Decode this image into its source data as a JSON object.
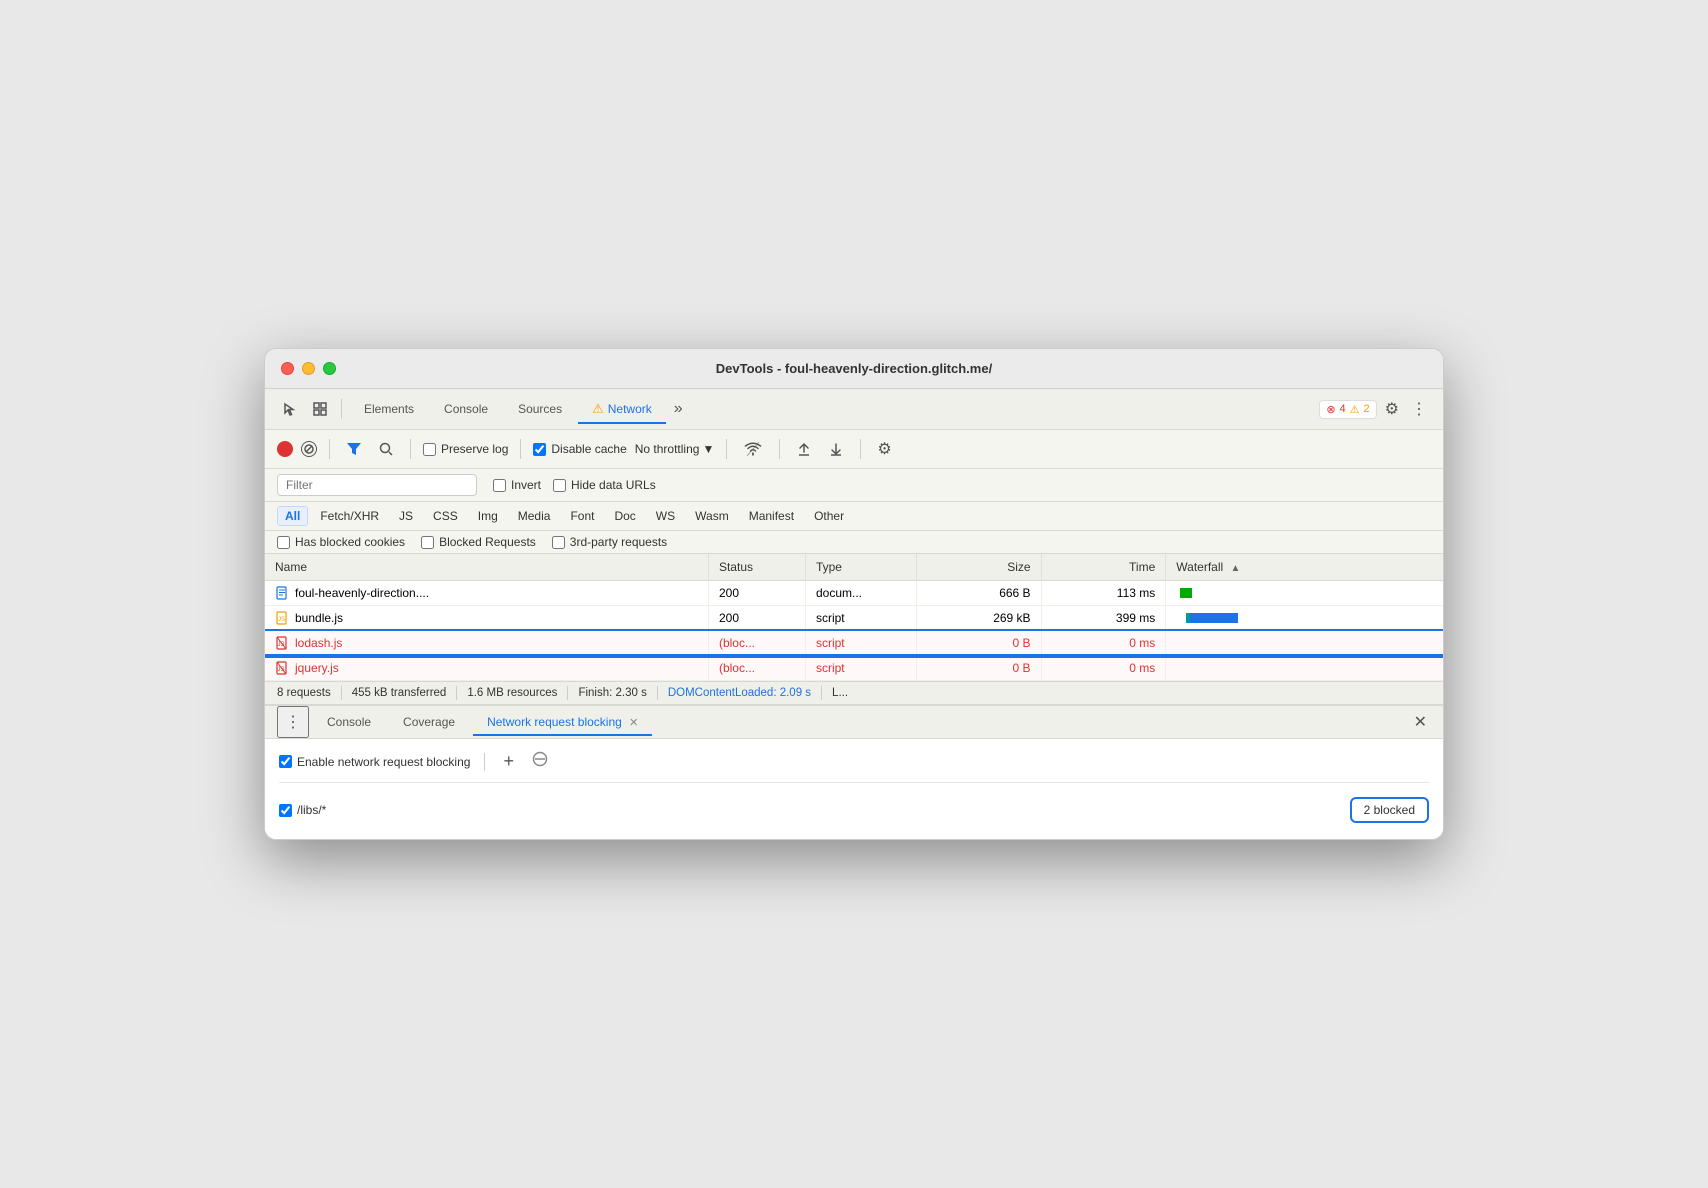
{
  "window": {
    "title": "DevTools - foul-heavenly-direction.glitch.me/"
  },
  "toolbar": {
    "tabs": [
      {
        "id": "elements",
        "label": "Elements",
        "active": false
      },
      {
        "id": "console",
        "label": "Console",
        "active": false
      },
      {
        "id": "sources",
        "label": "Sources",
        "active": false
      },
      {
        "id": "network",
        "label": "Network",
        "active": true
      },
      {
        "id": "more",
        "label": "»",
        "active": false
      }
    ],
    "error_count": "4",
    "warn_count": "2"
  },
  "network_toolbar": {
    "preserve_log_label": "Preserve log",
    "disable_cache_label": "Disable cache",
    "throttle_label": "No throttling"
  },
  "filter_bar": {
    "filter_placeholder": "Filter",
    "invert_label": "Invert",
    "hide_data_urls_label": "Hide data URLs"
  },
  "type_filters": [
    {
      "label": "All",
      "active": true
    },
    {
      "label": "Fetch/XHR",
      "active": false
    },
    {
      "label": "JS",
      "active": false
    },
    {
      "label": "CSS",
      "active": false
    },
    {
      "label": "Img",
      "active": false
    },
    {
      "label": "Media",
      "active": false
    },
    {
      "label": "Font",
      "active": false
    },
    {
      "label": "Doc",
      "active": false
    },
    {
      "label": "WS",
      "active": false
    },
    {
      "label": "Wasm",
      "active": false
    },
    {
      "label": "Manifest",
      "active": false
    },
    {
      "label": "Other",
      "active": false
    }
  ],
  "extra_filters": {
    "blocked_cookies": "Has blocked cookies",
    "blocked_requests": "Blocked Requests",
    "third_party": "3rd-party requests"
  },
  "table": {
    "headers": [
      "Name",
      "Status",
      "Type",
      "Size",
      "Time",
      "Waterfall"
    ],
    "rows": [
      {
        "name": "foul-heavenly-direction....",
        "status": "200",
        "type": "docum...",
        "size": "666 B",
        "time": "113 ms",
        "blocked": false,
        "icon": "doc"
      },
      {
        "name": "bundle.js",
        "status": "200",
        "type": "script",
        "size": "269 kB",
        "time": "399 ms",
        "blocked": false,
        "icon": "js"
      },
      {
        "name": "lodash.js",
        "status": "(bloc...",
        "type": "script",
        "size": "0 B",
        "time": "0 ms",
        "blocked": true,
        "icon": "blocked"
      },
      {
        "name": "jquery.js",
        "status": "(bloc...",
        "type": "script",
        "size": "0 B",
        "time": "0 ms",
        "blocked": true,
        "icon": "blocked"
      }
    ]
  },
  "status_bar": {
    "requests": "8 requests",
    "transferred": "455 kB transferred",
    "resources": "1.6 MB resources",
    "finish": "Finish: 2.30 s",
    "dom_content_loaded": "DOMContentLoaded: 2.09 s",
    "load": "L..."
  },
  "bottom_panel": {
    "tabs": [
      {
        "label": "Console",
        "active": false,
        "closable": false
      },
      {
        "label": "Coverage",
        "active": false,
        "closable": false
      },
      {
        "label": "Network request blocking",
        "active": true,
        "closable": true
      }
    ],
    "enable_blocking_label": "Enable network request blocking",
    "blocking_rules": [
      {
        "pattern": "/libs/*",
        "blocked_count": "2 blocked"
      }
    ],
    "add_label": "+",
    "no_label": "🚫"
  }
}
